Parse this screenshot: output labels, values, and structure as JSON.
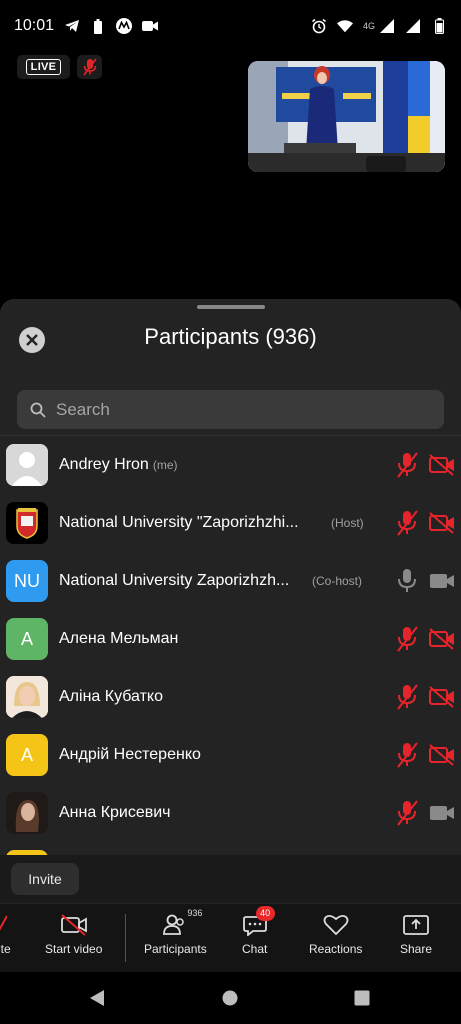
{
  "status_bar": {
    "time": "10:01",
    "network": "4G"
  },
  "live_badge": "LIVE",
  "panel": {
    "title": "Participants (936)",
    "search_placeholder": "Search"
  },
  "participants": [
    {
      "name": "Andrey Hron",
      "role": "(me)",
      "avatar_text": "",
      "avatar_color": "#d0d0d0",
      "mic": "muted",
      "cam": "off"
    },
    {
      "name": "National University \"Zaporizhzhi...",
      "role": "(Host)",
      "avatar_text": "",
      "avatar_color": "#000000",
      "mic": "muted",
      "cam": "off"
    },
    {
      "name": "National University Zaporizhzh...",
      "role": "(Co-host)",
      "avatar_text": "NU",
      "avatar_color": "#2f9bf0",
      "mic": "on",
      "cam": "on"
    },
    {
      "name": "Алена  Мельман",
      "role": "",
      "avatar_text": "A",
      "avatar_color": "#5fb566",
      "mic": "muted",
      "cam": "off"
    },
    {
      "name": "Аліна Кубатко",
      "role": "",
      "avatar_text": "",
      "avatar_color": "#e9d2c0",
      "mic": "muted",
      "cam": "off"
    },
    {
      "name": "Андрій Нестеренко",
      "role": "",
      "avatar_text": "A",
      "avatar_color": "#f4c417",
      "mic": "muted",
      "cam": "off"
    },
    {
      "name": "Анна Крисевич",
      "role": "",
      "avatar_text": "",
      "avatar_color": "#3a2a28",
      "mic": "muted",
      "cam": "on"
    }
  ],
  "invite_label": "Invite",
  "toolbar": {
    "mute_label": "ute",
    "start_video_label": "Start video",
    "participants_label": "Participants",
    "participants_count": "936",
    "chat_label": "Chat",
    "chat_badge": "40",
    "reactions_label": "Reactions",
    "share_label": "Share"
  },
  "colors": {
    "muted_red": "#e5252b",
    "panel_bg": "#232323",
    "accent_blue": "#2f9bf0"
  }
}
